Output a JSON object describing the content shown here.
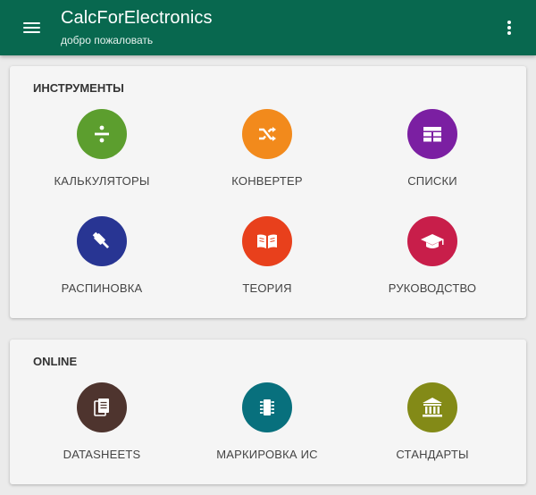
{
  "appbar": {
    "title": "CalcForElectronics",
    "subtitle": "добро пожаловать"
  },
  "sections": {
    "tools": {
      "title": "ИНСТРУМЕНТЫ",
      "items": [
        {
          "label": "КАЛЬКУЛЯТОРЫ",
          "icon": "divide-icon",
          "color": "#5c9e2e"
        },
        {
          "label": "КОНВЕРТЕР",
          "icon": "shuffle-icon",
          "color": "#f28a1c"
        },
        {
          "label": "СПИСКИ",
          "icon": "table-list-icon",
          "color": "#7b1fa2"
        },
        {
          "label": "РАСПИНОВКА",
          "icon": "usb-plug-icon",
          "color": "#283593"
        },
        {
          "label": "ТЕОРИЯ",
          "icon": "book-icon",
          "color": "#e8401c"
        },
        {
          "label": "РУКОВОДСТВО",
          "icon": "graduation-cap-icon",
          "color": "#c81e4a"
        }
      ]
    },
    "online": {
      "title": "ONLINE",
      "items": [
        {
          "label": "DATASHEETS",
          "icon": "documents-icon",
          "color": "#4e342e"
        },
        {
          "label": "МАРКИРОВКА ИС",
          "icon": "chip-icon",
          "color": "#08707d"
        },
        {
          "label": "СТАНДАРТЫ",
          "icon": "institution-icon",
          "color": "#838a17"
        }
      ]
    }
  }
}
